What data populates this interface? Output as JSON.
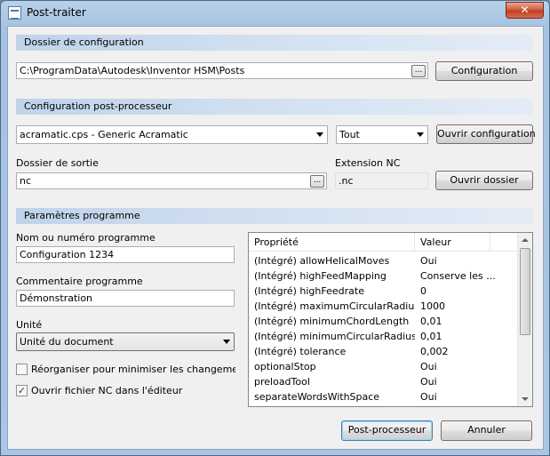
{
  "window": {
    "title": "Post-traiter",
    "close_glyph": "✕"
  },
  "config_section": {
    "header": "Dossier de configuration",
    "path": "C:\\ProgramData\\Autodesk\\Inventor HSM\\Posts",
    "browse_label": "...",
    "config_button": "Configuration"
  },
  "post_section": {
    "header": "Configuration post-processeur",
    "post_select": "acramatic.cps - Generic Acramatic",
    "filter_select": "Tout",
    "open_config_button": "Ouvrir configuration",
    "output_folder_label": "Dossier de sortie",
    "output_folder_value": "nc",
    "output_browse_label": "...",
    "extension_label": "Extension NC",
    "extension_value": ".nc",
    "open_folder_button": "Ouvrir dossier"
  },
  "program_section": {
    "header": "Paramètres programme",
    "name_label": "Nom ou numéro programme",
    "name_value": "Configuration 1234",
    "comment_label": "Commentaire programme",
    "comment_value": "Démonstration",
    "unit_label": "Unité",
    "unit_value": "Unité du document",
    "reorder_label": "Réorganiser pour minimiser les changements d'ou",
    "reorder_checked": false,
    "open_nc_label": "Ouvrir fichier NC dans l'éditeur",
    "open_nc_checked": true,
    "check_glyph": "✓"
  },
  "properties": {
    "col_property": "Propriété",
    "col_value": "Valeur",
    "rows": [
      {
        "name": "(Intégré) allowHelicalMoves",
        "value": "Oui"
      },
      {
        "name": "(Intégré) highFeedMapping",
        "value": "Conserve les ..."
      },
      {
        "name": "(Intégré) highFeedrate",
        "value": "0"
      },
      {
        "name": "(Intégré) maximumCircularRadius",
        "value": "1000"
      },
      {
        "name": "(Intégré) minimumChordLength",
        "value": "0,01"
      },
      {
        "name": "(Intégré) minimumCircularRadius",
        "value": "0,01"
      },
      {
        "name": "(Intégré) tolerance",
        "value": "0,002"
      },
      {
        "name": "optionalStop",
        "value": "Oui"
      },
      {
        "name": "preloadTool",
        "value": "Oui"
      },
      {
        "name": "separateWordsWithSpace",
        "value": "Oui"
      }
    ]
  },
  "footer": {
    "post_button": "Post-processeur",
    "cancel_button": "Annuler"
  }
}
